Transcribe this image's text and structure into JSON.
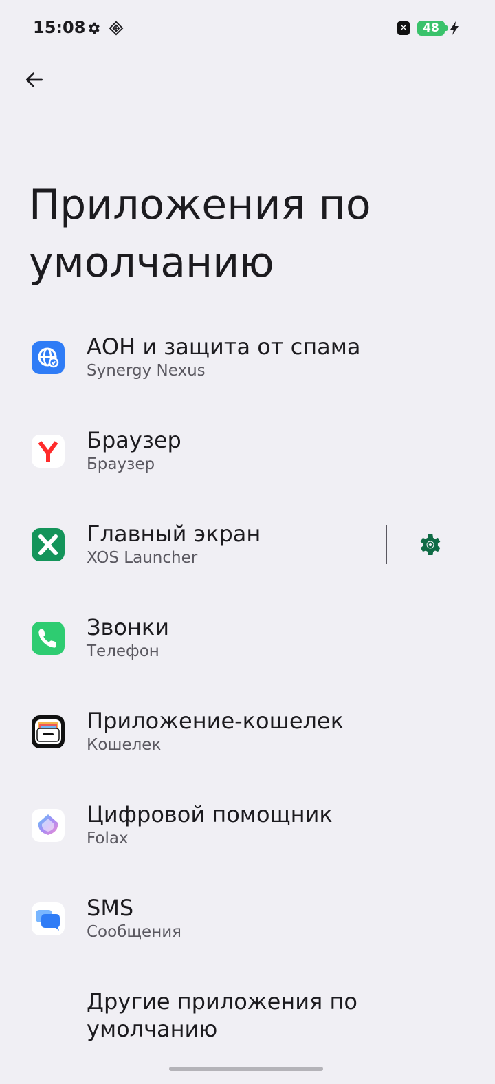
{
  "status_bar": {
    "time": "15:08",
    "battery_level": "48",
    "x_badge": "✕",
    "icons": [
      "settings-gear-icon",
      "diamond-grid-icon",
      "x-app-icon",
      "battery-icon",
      "charging-bolt-icon"
    ]
  },
  "page": {
    "title": "Приложения по умолчанию"
  },
  "items": [
    {
      "icon": "globe-shield-icon",
      "icon_color": "#2f7cf6",
      "title": "АОН и защита от спама",
      "subtitle": "Synergy Nexus"
    },
    {
      "icon": "yandex-browser-icon",
      "icon_color": "#ff2b2b",
      "title": "Браузер",
      "subtitle": "Браузер"
    },
    {
      "icon": "xos-launcher-icon",
      "icon_color": "#14945a",
      "title": "Главный экран",
      "subtitle": "XOS Launcher"
    },
    {
      "icon": "phone-icon",
      "icon_color": "#2ecc71",
      "title": "Звонки",
      "subtitle": "Телефон"
    },
    {
      "icon": "wallet-icon",
      "icon_color": "#111111",
      "title": "Приложение-кошелек",
      "subtitle": "Кошелек"
    },
    {
      "icon": "folax-assistant-icon",
      "icon_color": "#a58cf5",
      "title": "Цифровой помощник",
      "subtitle": "Folax"
    },
    {
      "icon": "messages-icon",
      "icon_color": "#2f7cf6",
      "title": "SMS",
      "subtitle": "Сообщения"
    }
  ],
  "other_apps": {
    "title": "Другие приложения по умолчанию"
  },
  "colors": {
    "background": "#f0eff4",
    "accent": "#0f6b45",
    "battery": "#3ac26b"
  }
}
